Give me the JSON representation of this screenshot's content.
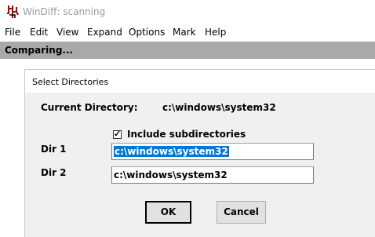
{
  "window": {
    "title": "WinDiff: scanning",
    "icon": "windiff-app-icon"
  },
  "menubar": {
    "items": [
      {
        "label": "File"
      },
      {
        "label": "Edit"
      },
      {
        "label": "View"
      },
      {
        "label": "Expand"
      },
      {
        "label": "Options"
      },
      {
        "label": "Mark"
      },
      {
        "label": "Help"
      }
    ]
  },
  "status": {
    "text": "Comparing..."
  },
  "dialog": {
    "title": "Select Directories",
    "current_directory_label": "Current Directory:",
    "current_directory_value": "c:\\windows\\system32",
    "include_subdirectories_label": "Include subdirectories",
    "include_subdirectories_checked": true,
    "dir1_label": "Dir 1",
    "dir1_value": "c:\\windows\\system32",
    "dir2_label": "Dir 2",
    "dir2_value": "c:\\windows\\system32",
    "ok_label": "OK",
    "cancel_label": "Cancel"
  },
  "colors": {
    "status_bar_bg": "#a9a9a9",
    "selection_bg": "#0078d7",
    "dialog_bg": "#f0f0f0"
  }
}
